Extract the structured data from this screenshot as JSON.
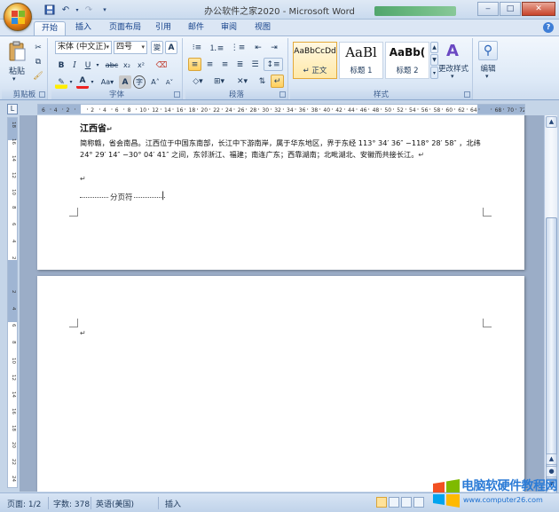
{
  "window": {
    "title": "办公软件之家2020 - Microsoft Word",
    "minimize": "‒",
    "maximize": "□",
    "close": "✕"
  },
  "tabs": [
    {
      "label": "开始"
    },
    {
      "label": "插入"
    },
    {
      "label": "页面布局"
    },
    {
      "label": "引用"
    },
    {
      "label": "邮件"
    },
    {
      "label": "审阅"
    },
    {
      "label": "视图"
    }
  ],
  "ribbon": {
    "clipboard": {
      "paste": "粘贴",
      "label": "剪贴板"
    },
    "font": {
      "font_name": "宋体 (中文正)",
      "font_size": "四号",
      "label": "字体"
    },
    "paragraph": {
      "label": "段落"
    },
    "styles": {
      "items": [
        {
          "sample": "AaBbCcDd",
          "name": "↵ 正文"
        },
        {
          "sample": "AaBl",
          "name": "标题 1"
        },
        {
          "sample": "AaBb(",
          "name": "标题 2"
        }
      ],
      "change_styles": "更改样式",
      "label": "样式"
    },
    "editing": {
      "label": "编辑"
    }
  },
  "ruler": {
    "h_ticks": [
      "6",
      "4",
      "2",
      "",
      "2",
      "4",
      "6",
      "8",
      "10",
      "12",
      "14",
      "16",
      "18",
      "20",
      "22",
      "24",
      "26",
      "28",
      "30",
      "32",
      "34",
      "36",
      "38",
      "40",
      "42",
      "44",
      "46",
      "48",
      "50",
      "52",
      "54",
      "56",
      "58",
      "60",
      "62",
      "64",
      "",
      "68",
      "70",
      "72"
    ],
    "v_ticks": [
      "18",
      "16",
      "14",
      "12",
      "10",
      "8",
      "6",
      "4",
      "2",
      "",
      "2",
      "4",
      "6",
      "8",
      "10",
      "12",
      "14",
      "16",
      "18",
      "20",
      "22",
      "24"
    ]
  },
  "document": {
    "heading": "江西省",
    "paragraph": "简称赣，省会南昌。江西位于中国东南部，长江中下游南岸，属于华东地区，界于东经 113° 34′ 36″ −118° 28′ 58″ ，北纬 24° 29′ 14″ −30° 04′ 41″ 之间，东邻浙江、福建；南连广东；西靠湖南；北毗湖北、安徽而共接长江。",
    "page_break": "分页符"
  },
  "status": {
    "page": "页面: 1/2",
    "words": "字数: 378",
    "language": "英语(美国)",
    "mode": "插入"
  },
  "watermark": {
    "brand": "电脑软硬件教程网",
    "url": "www.computer26.com"
  },
  "colors": {
    "accent": "#15428b",
    "ribbon_bg": "#dde9f7",
    "doc_bg": "#9badc7"
  }
}
